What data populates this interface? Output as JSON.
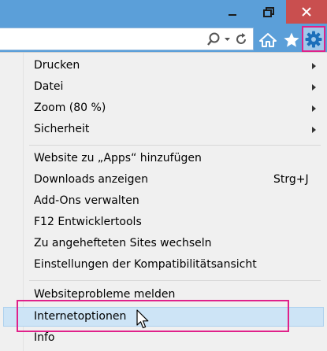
{
  "menu": {
    "items": [
      {
        "label": "Drucken",
        "submenu": true
      },
      {
        "label": "Datei",
        "submenu": true
      },
      {
        "label": "Zoom (80 %)",
        "submenu": true
      },
      {
        "label": "Sicherheit",
        "submenu": true
      },
      {
        "label": "Website zu „Apps“ hinzufügen"
      },
      {
        "label": "Downloads anzeigen",
        "shortcut": "Strg+J"
      },
      {
        "label": "Add-Ons verwalten"
      },
      {
        "label": "F12 Entwicklertools"
      },
      {
        "label": "Zu angehefteten Sites wechseln"
      },
      {
        "label": "Einstellungen der Kompatibilitätsansicht"
      },
      {
        "label": "Websiteprobleme melden"
      },
      {
        "label": "Internetoptionen",
        "highlighted": true
      },
      {
        "label": "Info"
      }
    ]
  },
  "icons": {
    "minimize": "minimize-icon",
    "maximize": "restore-icon",
    "close": "close-icon",
    "search": "search-icon",
    "dropdown": "chevron-down-icon",
    "refresh": "refresh-icon",
    "home": "home-icon",
    "favorites": "star-icon",
    "tools": "gear-icon",
    "cursor": "mouse-pointer-icon"
  },
  "colors": {
    "chrome": "#5b9fd9",
    "close_button": "#c94f4f",
    "menu_background": "#f0f0f0",
    "item_highlight": "#cde4f6",
    "annotation": "#e0218a"
  }
}
